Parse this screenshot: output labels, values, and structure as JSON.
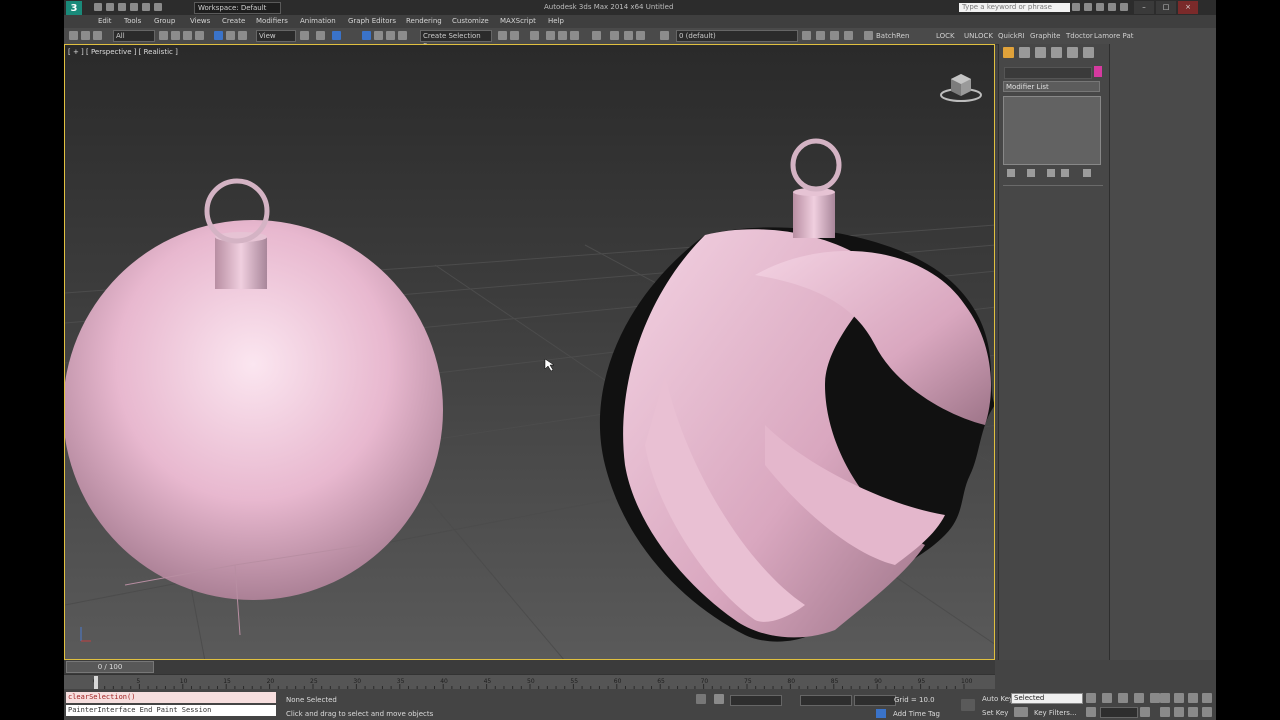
{
  "titlebar": {
    "workspace": "Workspace: Default",
    "app_title": "Autodesk 3ds Max 2014 x64     Untitled",
    "search_placeholder": "Type a keyword or phrase"
  },
  "menubar": {
    "items": [
      "Edit",
      "Tools",
      "Group",
      "Views",
      "Create",
      "Modifiers",
      "Animation",
      "Graph Editors",
      "Rendering",
      "Customize",
      "MAXScript",
      "Help"
    ]
  },
  "toolbar": {
    "filter": "All",
    "ref_coord": "View",
    "named_selection": "Create Selection Se",
    "layer": "0 (default)",
    "extras": [
      "BatchRen",
      "LOCK",
      "UNLOCK",
      "QuickRI",
      "Graphite",
      "Tdoctor",
      "Lamore Pat"
    ]
  },
  "viewport": {
    "label": "[ + ] [ Perspective ] [ Realistic ]"
  },
  "command_panel": {
    "modifier_list": "Modifier List"
  },
  "timeslider": {
    "position": "0 / 100"
  },
  "trackbar": {
    "ticks": [
      "0",
      "5",
      "10",
      "15",
      "20",
      "25",
      "30",
      "35",
      "40",
      "45",
      "50",
      "55",
      "60",
      "65",
      "70",
      "75",
      "80",
      "85",
      "90",
      "95",
      "100"
    ]
  },
  "status": {
    "maxscript_line1": "clearSelection()",
    "maxscript_line2": "PainterInterface End Paint Session",
    "selection_status": "None Selected",
    "prompt": "Click and drag to select and move objects",
    "grid": "Grid = 10.0",
    "auto_key": "Auto Key",
    "set_key": "Set Key",
    "selected_dropdown": "Selected",
    "key_filters": "Key Filters...",
    "add_time_tag": "Add Time Tag"
  },
  "colors": {
    "ornament": "#e8b8cf",
    "viewport_border": "#e0c040",
    "object_color_swatch": "#d63aa0"
  }
}
